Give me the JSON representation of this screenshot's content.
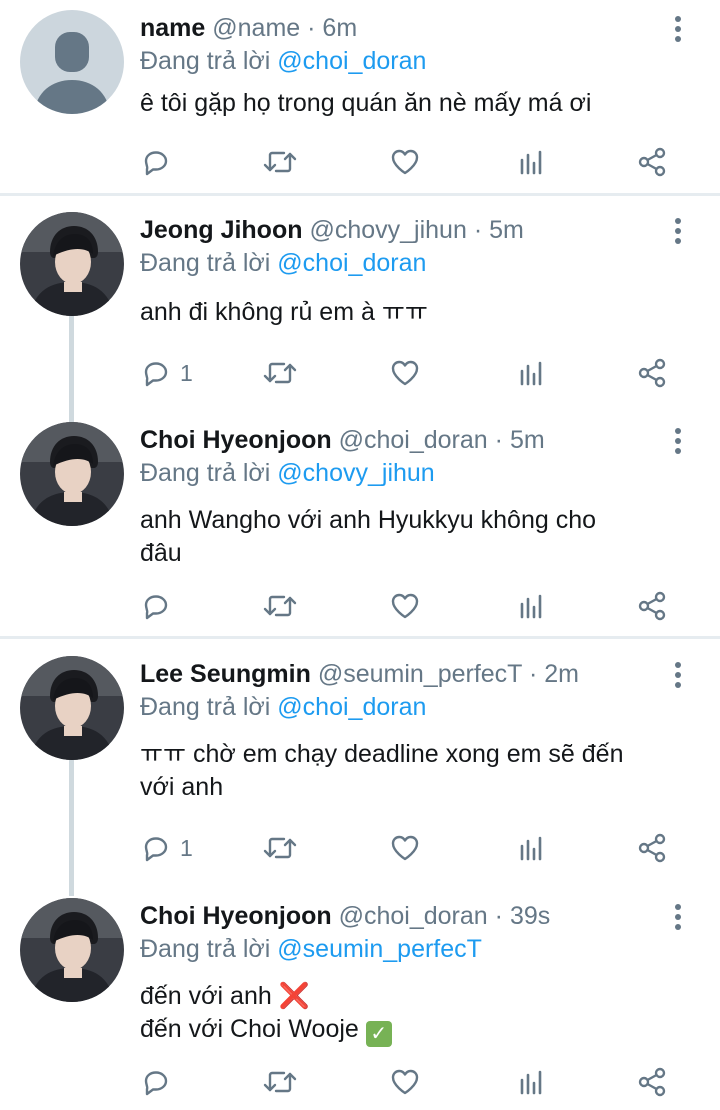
{
  "tweets": [
    {
      "name": "name",
      "handle": "@name",
      "dot": "·",
      "time": "6m",
      "reply_prefix": "Đang trả lời",
      "reply_to": "@choi_doran",
      "text": "ê tôi gặp họ trong quán ăn nè mấy má ơi",
      "reply_count": "",
      "avatar": "default-avatar"
    },
    {
      "name": "Jeong Jihoon",
      "handle": "@chovy_jihun",
      "dot": "·",
      "time": "5m",
      "reply_prefix": "Đang trả lời",
      "reply_to": "@choi_doran",
      "text": "anh đi không rủ em à ㅠㅠ",
      "reply_count": "1",
      "avatar": "profile-photo"
    },
    {
      "name": "Choi Hyeonjoon",
      "handle": "@choi_doran",
      "dot": "·",
      "time": "5m",
      "reply_prefix": "Đang trả lời",
      "reply_to": "@chovy_jihun",
      "text_lines": [
        "anh Wangho với anh Hyukkyu không cho",
        "đâu"
      ],
      "reply_count": "",
      "avatar": "profile-photo"
    },
    {
      "name": "Lee Seungmin",
      "handle": "@seumin_perfecT",
      "dot": "·",
      "time": "2m",
      "reply_prefix": "Đang trả lời",
      "reply_to": "@choi_doran",
      "text_lines": [
        "ㅠㅠ chờ em chạy deadline xong em sẽ đến",
        "với anh"
      ],
      "reply_count": "1",
      "avatar": "profile-photo"
    },
    {
      "name": "Choi Hyeonjoon",
      "handle": "@choi_doran",
      "dot": "·",
      "time": "39s",
      "reply_prefix": "Đang trả lời",
      "reply_to": "@seumin_perfecT",
      "text_lines": [
        "đến với anh",
        "đến với Choi Wooje"
      ],
      "line_emojis": [
        "❌",
        "✓"
      ],
      "reply_count": "",
      "avatar": "profile-photo"
    }
  ],
  "icons": {
    "reply": "reply-icon",
    "retweet": "retweet-icon",
    "like": "like-icon",
    "analytics": "analytics-icon",
    "share": "share-icon",
    "more": "more-icon"
  },
  "colors": {
    "mention": "#1d9bf0",
    "secondary_text": "#657786",
    "thread_line": "#cfd9de"
  }
}
